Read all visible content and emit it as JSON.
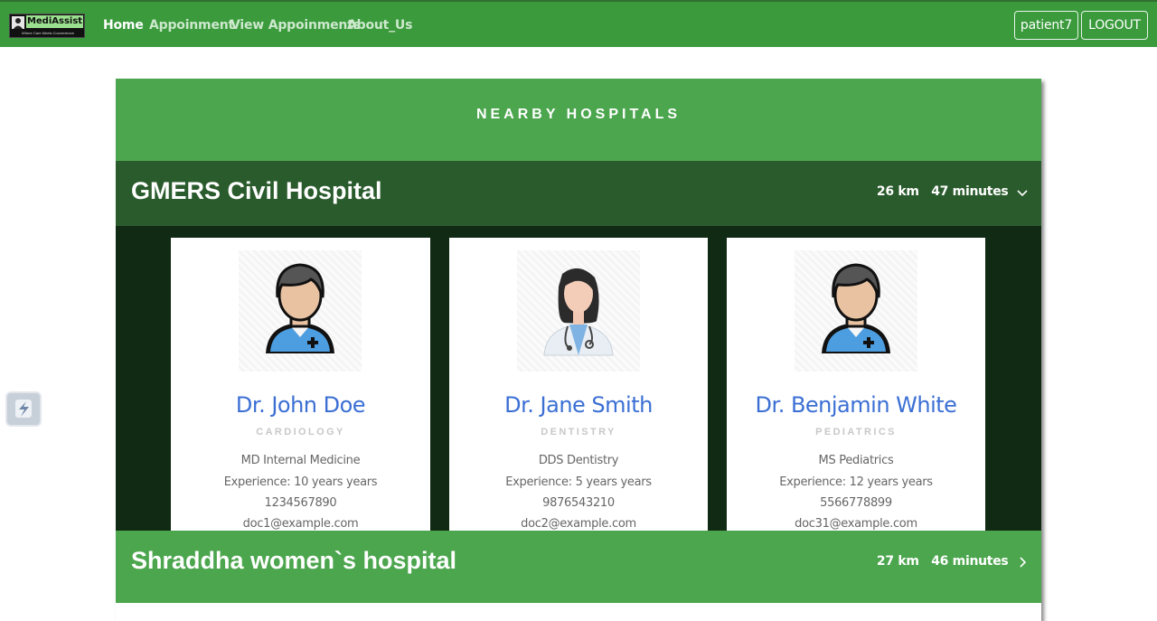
{
  "navbar": {
    "logo_text": "MediAssist",
    "logo_tagline": "Where Care Meets Convenience",
    "links": [
      "Home",
      "Appoinment",
      "View Appoinments",
      "About_Us"
    ],
    "user_button": "patient7",
    "logout_button": "LOGOUT",
    "background_color": "#3a9a3c"
  },
  "panel": {
    "title": "NEARBY HOSPITALS"
  },
  "hospitals": [
    {
      "name": "GMERS Civil Hospital",
      "distance": "26 km",
      "duration": "47 minutes",
      "expanded": true,
      "chevron_icon": "chevron-down-icon",
      "doctors": [
        {
          "name": "Dr. John Doe",
          "specialty": "CARDIOLOGY",
          "degree": "MD Internal Medicine",
          "experience": "Experience: 10 years years",
          "phone": "1234567890",
          "email": "doc1@example.com",
          "avatar_icon": "male-doctor-icon"
        },
        {
          "name": "Dr. Jane Smith",
          "specialty": "DENTISTRY",
          "degree": "DDS Dentistry",
          "experience": "Experience: 5 years years",
          "phone": "9876543210",
          "email": "doc2@example.com",
          "avatar_icon": "female-doctor-icon"
        },
        {
          "name": "Dr. Benjamin White",
          "specialty": "PEDIATRICS",
          "degree": "MS Pediatrics",
          "experience": "Experience: 12 years years",
          "phone": "5566778899",
          "email": "doc31@example.com",
          "avatar_icon": "male-doctor-icon"
        }
      ]
    },
    {
      "name": "Shraddha women`s hospital",
      "distance": "27 km",
      "duration": "46 minutes",
      "expanded": false,
      "chevron_icon": "chevron-right-icon"
    }
  ],
  "colors": {
    "header_green": "#4ca64e",
    "dark_green": "#2a5b2c",
    "doctor_area": "#102a14",
    "doctor_name_blue": "#3b6fd4"
  },
  "floating_button_icon": "lightning-icon"
}
